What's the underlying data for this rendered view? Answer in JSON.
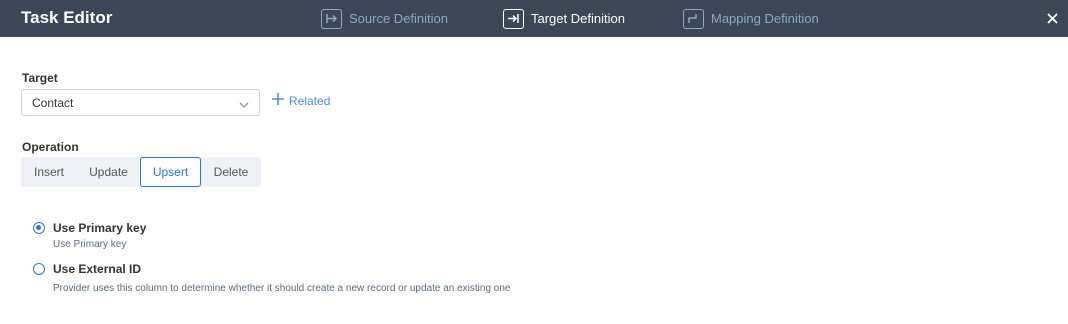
{
  "header": {
    "title": "Task Editor",
    "tabs": [
      {
        "label": "Source Definition",
        "icon": "source-icon",
        "active": false
      },
      {
        "label": "Target Definition",
        "icon": "target-icon",
        "active": true
      },
      {
        "label": "Mapping Definition",
        "icon": "mapping-icon",
        "active": false
      }
    ],
    "close_icon": "close-icon"
  },
  "target": {
    "label": "Target",
    "selected": "Contact",
    "related_label": "Related"
  },
  "operation": {
    "label": "Operation",
    "options": [
      "Insert",
      "Update",
      "Upsert",
      "Delete"
    ],
    "selected": "Upsert"
  },
  "keys": {
    "options": [
      {
        "title": "Use Primary key",
        "description": "Use Primary key",
        "checked": true
      },
      {
        "title": "Use External ID",
        "description": "Provider uses this column to determine whether it should create a new record or update an existing one",
        "checked": false
      }
    ]
  },
  "colors": {
    "header_bg": "#3b4757",
    "accent": "#2b76d2",
    "tab_inactive": "#8fa7c4",
    "link": "#4a90e2"
  }
}
